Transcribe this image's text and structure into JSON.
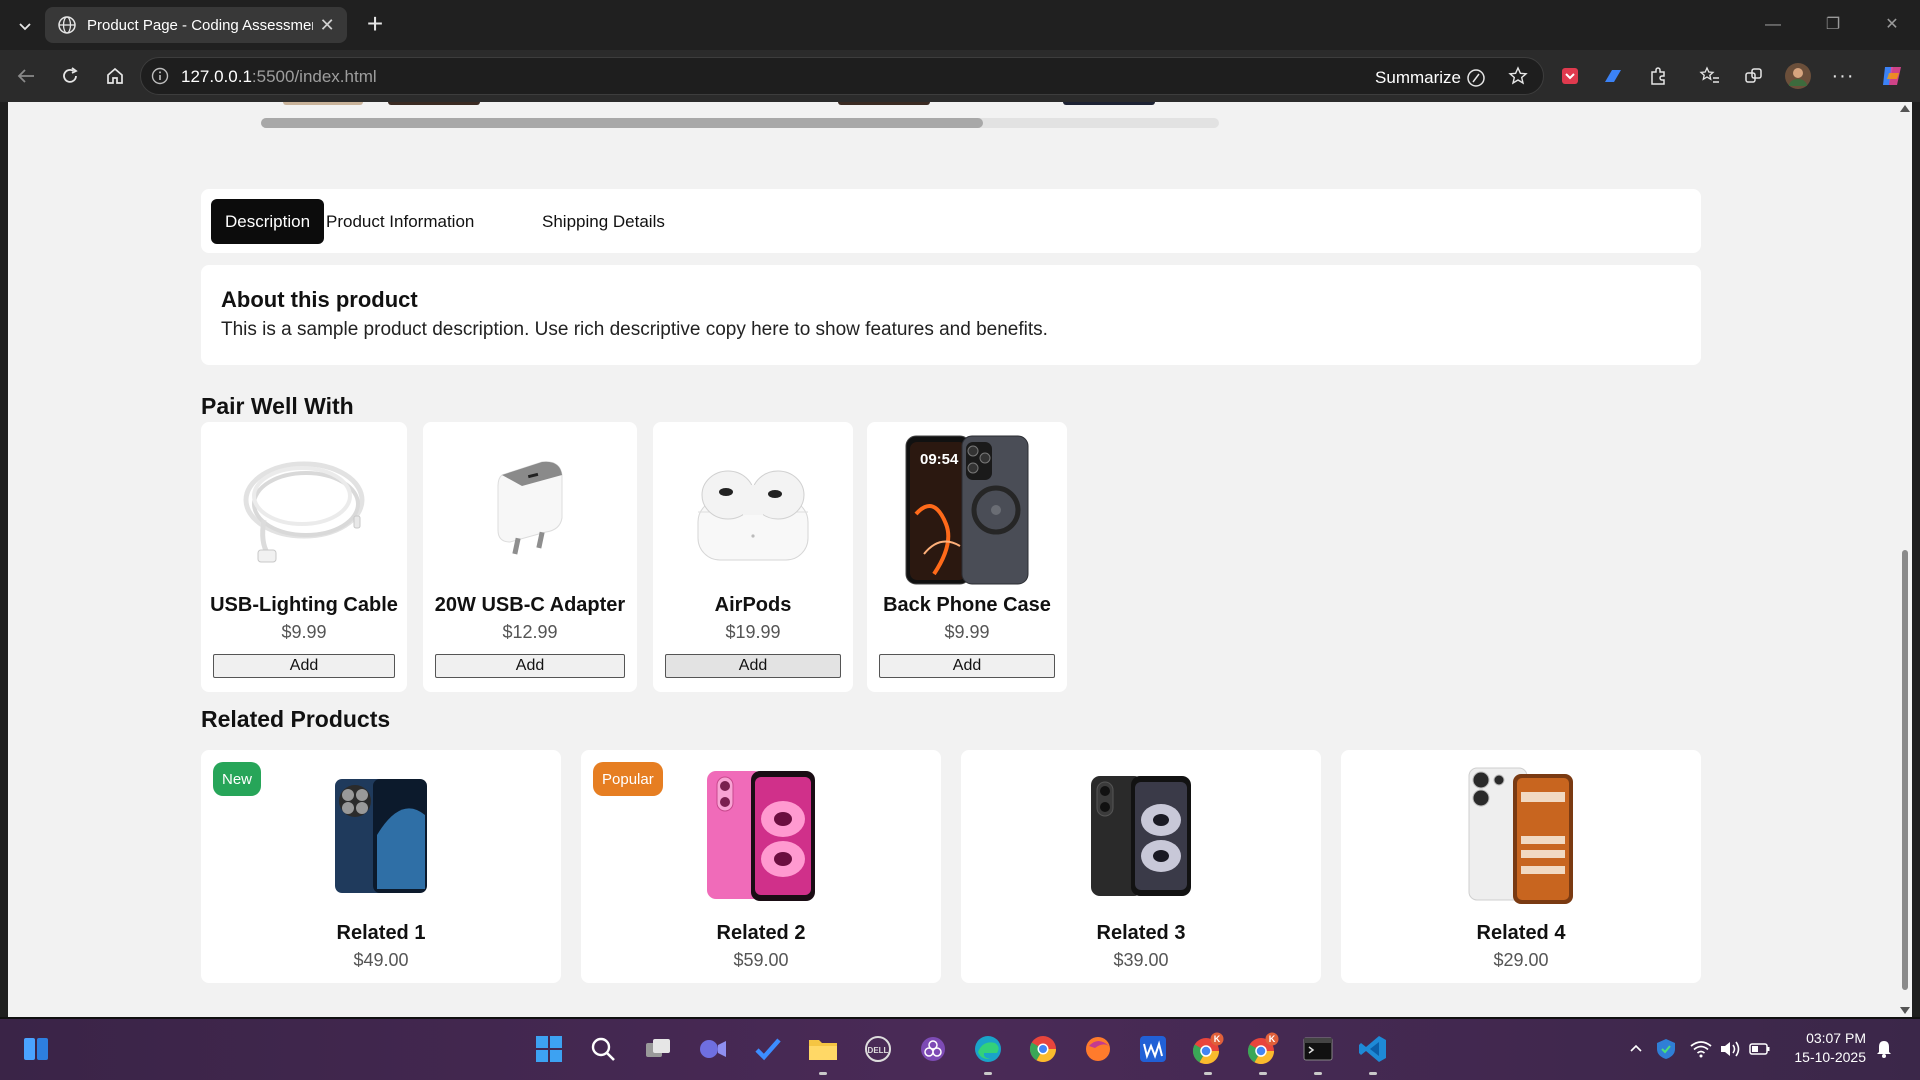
{
  "browser": {
    "tab_title": "Product Page - Coding Assessment",
    "url_host": "127.0.0.1",
    "url_rest": ":5500/index.html",
    "summarize_label": "Summarize"
  },
  "product_tabs": [
    {
      "label": "Description",
      "active": true
    },
    {
      "label": "Product Information",
      "active": false
    },
    {
      "label": "Shipping Details",
      "active": false
    }
  ],
  "description": {
    "heading": "About this product",
    "text": "This is a sample product description. Use rich descriptive copy here to show features and benefits."
  },
  "pair_section_title": "Pair Well With",
  "pair_items": [
    {
      "name": "USB-Lighting Cable",
      "price": "$9.99",
      "button": "Add",
      "icon": "cable-image"
    },
    {
      "name": "20W USB-C Adapter",
      "price": "$12.99",
      "button": "Add",
      "icon": "adapter-image"
    },
    {
      "name": "AirPods",
      "price": "$19.99",
      "button": "Add",
      "icon": "airpods-image"
    },
    {
      "name": "Back Phone Case",
      "price": "$9.99",
      "button": "Add",
      "icon": "phone-case-image",
      "image_clock": "09:54"
    }
  ],
  "related_section_title": "Related Products",
  "related_items": [
    {
      "name": "Related 1",
      "price": "$49.00",
      "badge": "New",
      "badge_color": "#27a559"
    },
    {
      "name": "Related 2",
      "price": "$59.00",
      "badge": "Popular",
      "badge_color": "#e67e22"
    },
    {
      "name": "Related 3",
      "price": "$39.00",
      "badge": "",
      "badge_color": ""
    },
    {
      "name": "Related 4",
      "price": "$29.00",
      "badge": "",
      "badge_color": ""
    }
  ],
  "taskbar": {
    "time": "03:07 PM",
    "date": "15-10-2025",
    "chrome_badge": "K"
  },
  "colors": {
    "page_bg": "#f2f2f2",
    "active_tab_bg": "#0c0c0c",
    "taskbar": "#4a2a57"
  }
}
